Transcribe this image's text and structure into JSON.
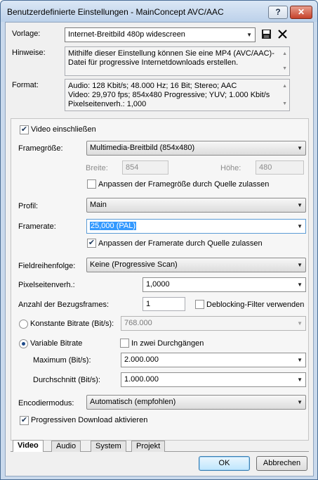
{
  "window": {
    "title": "Benutzerdefinierte Einstellungen - MainConcept AVC/AAC",
    "help_label": "?",
    "close_label": "✕"
  },
  "template": {
    "label": "Vorlage:",
    "value": "Internet-Breitbild 480p widescreen",
    "save_icon": "save-icon",
    "delete_icon": "delete-icon"
  },
  "notes": {
    "label": "Hinweise:",
    "text": "Mithilfe dieser Einstellung können Sie eine MP4 (AVC/AAC)-Datei für progressive Internetdownloads erstellen."
  },
  "format": {
    "label": "Format:",
    "lines": [
      "Audio: 128 Kbit/s; 48.000 Hz; 16 Bit; Stereo; AAC",
      "Video: 29,970 fps; 854x480 Progressive; YUV; 1.000 Kbit/s",
      "Pixelseitenverh.: 1,000"
    ]
  },
  "video": {
    "include_label": "Video einschließen",
    "include_checked": true,
    "frame_size_label": "Framegröße:",
    "frame_size_value": "Multimedia-Breitbild (854x480)",
    "width_label": "Breite:",
    "width_value": "854",
    "height_label": "Höhe:",
    "height_value": "480",
    "allow_source_frame_label": "Anpassen der Framegröße durch Quelle zulassen",
    "allow_source_frame_checked": false,
    "profile_label": "Profil:",
    "profile_value": "Main",
    "framerate_label": "Framerate:",
    "framerate_value": "25,000 (PAL)",
    "allow_source_framerate_label": "Anpassen der Framerate durch Quelle zulassen",
    "allow_source_framerate_checked": true,
    "field_order_label": "Fieldreihenfolge:",
    "field_order_value": "Keine (Progressive Scan)",
    "pixel_aspect_label": "Pixelseitenverh.:",
    "pixel_aspect_value": "1,0000",
    "ref_frames_label": "Anzahl der Bezugsframes:",
    "ref_frames_value": "1",
    "deblocking_label": "Deblocking-Filter verwenden",
    "deblocking_checked": false,
    "cbr_label": "Konstante Bitrate (Bit/s):",
    "cbr_value": "768.000",
    "vbr_label": "Variable Bitrate",
    "two_pass_label": "In zwei Durchgängen",
    "two_pass_checked": false,
    "max_label": "Maximum (Bit/s):",
    "max_value": "2.000.000",
    "avg_label": "Durchschnitt (Bit/s):",
    "avg_value": "1.000.000",
    "encode_mode_label": "Encodiermodus:",
    "encode_mode_value": "Automatisch (empfohlen)",
    "progressive_download_label": "Progressiven Download aktivieren",
    "progressive_download_checked": true
  },
  "tabs": [
    "Video",
    "Audio",
    "System",
    "Projekt"
  ],
  "buttons": {
    "ok": "OK",
    "cancel": "Abbrechen"
  }
}
